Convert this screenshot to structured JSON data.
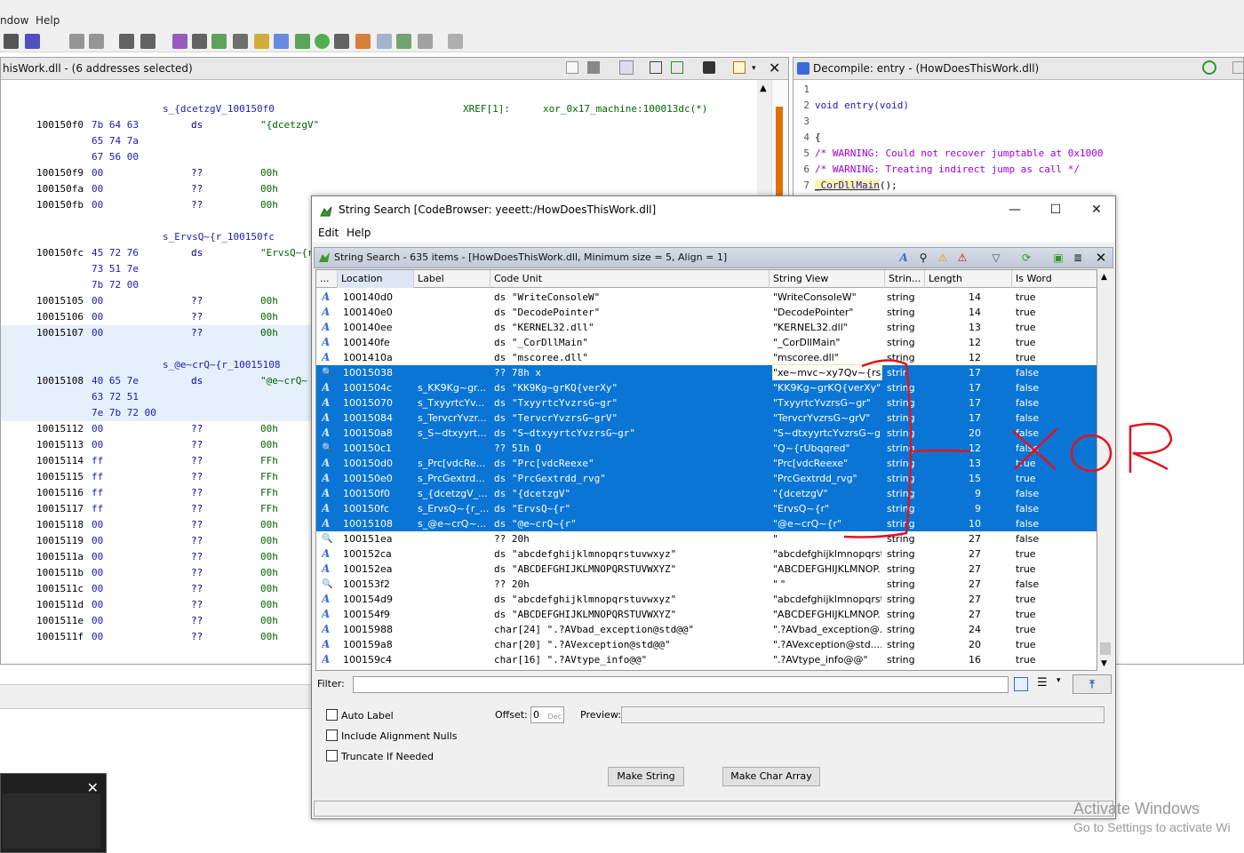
{
  "menubar": {
    "items": [
      "ndow",
      "Help"
    ]
  },
  "toolbar": {
    "icons": [
      "ghidra-logo-icon",
      "bookmark-icon",
      "cut-icon",
      "copy-icon",
      "undo-icon",
      "redo-icon",
      "check-icon",
      "label-icon",
      "export-icon",
      "memory-icon",
      "folder-icon",
      "function-icon",
      "tree-icon",
      "run-icon",
      "terminal-icon",
      "diamond-icon",
      "table-icon",
      "image-icon",
      "person-icon",
      "settings-icon"
    ]
  },
  "listing": {
    "title": "hisWork.dll - (6 addresses selected)",
    "rows": [
      {
        "type": "label",
        "label": "s_{dcetzgV_100150f0",
        "xref": "XREF[1]:",
        "xref_target": "xor_0x17_machine:100013dc(*)"
      },
      {
        "type": "data",
        "addr": "100150f0",
        "bytes": "7b 64 63",
        "mnem": "ds",
        "val": "\"{dcetzgV\""
      },
      {
        "type": "cont",
        "bytes": "65 74 7a"
      },
      {
        "type": "cont",
        "bytes": "67 56 00"
      },
      {
        "type": "data",
        "addr": "100150f9",
        "bytes": "00",
        "mnem": "??",
        "val": "00h"
      },
      {
        "type": "data",
        "addr": "100150fa",
        "bytes": "00",
        "mnem": "??",
        "val": "00h"
      },
      {
        "type": "data",
        "addr": "100150fb",
        "bytes": "00",
        "mnem": "??",
        "val": "00h"
      },
      {
        "type": "blank"
      },
      {
        "type": "label",
        "label": "s_ErvsQ~{r_100150fc"
      },
      {
        "type": "data",
        "addr": "100150fc",
        "bytes": "45 72 76",
        "mnem": "ds",
        "val": "\"ErvsQ~{r"
      },
      {
        "type": "cont",
        "bytes": "73 51 7e"
      },
      {
        "type": "cont",
        "bytes": "7b 72 00"
      },
      {
        "type": "data",
        "addr": "10015105",
        "bytes": "00",
        "mnem": "??",
        "val": "00h"
      },
      {
        "type": "data",
        "addr": "10015106",
        "bytes": "00",
        "mnem": "??",
        "val": "00h"
      },
      {
        "type": "data",
        "addr": "10015107",
        "bytes": "00",
        "mnem": "??",
        "val": "00h"
      },
      {
        "type": "blank"
      },
      {
        "type": "label",
        "label": "s_@e~crQ~{r_10015108"
      },
      {
        "type": "data",
        "addr": "10015108",
        "bytes": "40 65 7e",
        "mnem": "ds",
        "val": "\"@e~crQ~"
      },
      {
        "type": "cont",
        "bytes": "63 72 51"
      },
      {
        "type": "cont",
        "bytes": "7e 7b 72 00"
      },
      {
        "type": "data",
        "addr": "10015112",
        "bytes": "00",
        "mnem": "??",
        "val": "00h"
      },
      {
        "type": "data",
        "addr": "10015113",
        "bytes": "00",
        "mnem": "??",
        "val": "00h"
      },
      {
        "type": "data",
        "addr": "10015114",
        "bytes": "ff",
        "mnem": "??",
        "val": "FFh"
      },
      {
        "type": "data",
        "addr": "10015115",
        "bytes": "ff",
        "mnem": "??",
        "val": "FFh"
      },
      {
        "type": "data",
        "addr": "10015116",
        "bytes": "ff",
        "mnem": "??",
        "val": "FFh"
      },
      {
        "type": "data",
        "addr": "10015117",
        "bytes": "ff",
        "mnem": "??",
        "val": "FFh"
      },
      {
        "type": "data",
        "addr": "10015118",
        "bytes": "00",
        "mnem": "??",
        "val": "00h"
      },
      {
        "type": "data",
        "addr": "10015119",
        "bytes": "00",
        "mnem": "??",
        "val": "00h"
      },
      {
        "type": "data",
        "addr": "1001511a",
        "bytes": "00",
        "mnem": "??",
        "val": "00h"
      },
      {
        "type": "data",
        "addr": "1001511b",
        "bytes": "00",
        "mnem": "??",
        "val": "00h"
      },
      {
        "type": "data",
        "addr": "1001511c",
        "bytes": "00",
        "mnem": "??",
        "val": "00h"
      },
      {
        "type": "data",
        "addr": "1001511d",
        "bytes": "00",
        "mnem": "??",
        "val": "00h"
      },
      {
        "type": "data",
        "addr": "1001511e",
        "bytes": "00",
        "mnem": "??",
        "val": "00h"
      },
      {
        "type": "data",
        "addr": "1001511f",
        "bytes": "00",
        "mnem": "??",
        "val": "00h"
      }
    ]
  },
  "decompile": {
    "title": "Decompile: entry - (HowDoesThisWork.dll)",
    "lines": [
      {
        "n": "1",
        "parts": []
      },
      {
        "n": "2",
        "parts": [
          {
            "c": "kw",
            "t": "void entry(void)"
          }
        ]
      },
      {
        "n": "3",
        "parts": []
      },
      {
        "n": "4",
        "parts": [
          {
            "c": "",
            "t": "{"
          }
        ]
      },
      {
        "n": "5",
        "parts": [
          {
            "c": "cmt",
            "t": "                   /* WARNING: Could not recover jumptable at 0x1000"
          }
        ]
      },
      {
        "n": "6",
        "parts": [
          {
            "c": "cmt",
            "t": "                   /* WARNING: Treating indirect jump as call */"
          }
        ]
      },
      {
        "n": "7",
        "parts": [
          {
            "c": "",
            "t": "  "
          },
          {
            "c": "fn",
            "t": "_CorDllMain"
          },
          {
            "c": "",
            "t": "();"
          }
        ]
      }
    ]
  },
  "dialog": {
    "title": "String Search [CodeBrowser: yeeett:/HowDoesThisWork.dll]",
    "menu": [
      "Edit",
      "Help"
    ],
    "panel_title": "String Search - 635 items - [HowDoesThisWork.dll, Minimum size = 5, Align = 1]",
    "columns": [
      "...",
      "Location",
      "Label",
      "Code Unit",
      "String View",
      "Strin...",
      "Length",
      "Is Word"
    ],
    "rows": [
      {
        "icon": "A",
        "loc": "100140d0",
        "label": "",
        "code": "ds \"WriteConsoleW\"",
        "view": "\"WriteConsoleW\"",
        "type": "string",
        "len": "14",
        "word": "true",
        "sel": false
      },
      {
        "icon": "A",
        "loc": "100140e0",
        "label": "",
        "code": "ds \"DecodePointer\"",
        "view": "\"DecodePointer\"",
        "type": "string",
        "len": "14",
        "word": "true",
        "sel": false
      },
      {
        "icon": "A",
        "loc": "100140ee",
        "label": "",
        "code": "ds \"KERNEL32.dll\"",
        "view": "\"KERNEL32.dll\"",
        "type": "string",
        "len": "13",
        "word": "true",
        "sel": false
      },
      {
        "icon": "A",
        "loc": "100140fe",
        "label": "",
        "code": "ds \"_CorDllMain\"",
        "view": "\"_CorDllMain\"",
        "type": "string",
        "len": "12",
        "word": "true",
        "sel": false
      },
      {
        "icon": "A",
        "loc": "1001410a",
        "label": "",
        "code": "ds \"mscoree.dll\"",
        "view": "\"mscoree.dll\"",
        "type": "string",
        "len": "12",
        "word": "true",
        "sel": false
      },
      {
        "icon": "S",
        "loc": "10015038",
        "label": "",
        "code": "?? 78h    x",
        "view": "\"xe~mvc~xy7Qv~{rs\"",
        "type": "strin",
        "len": "17",
        "word": "false",
        "sel": true
      },
      {
        "icon": "A",
        "loc": "1001504c",
        "label": "s_KK9Kg~gr...",
        "code": "ds \"KK9Kg~grKQ{verXy\"",
        "view": "\"KK9Kg~grKQ{verXy\"",
        "type": "string",
        "len": "17",
        "word": "false",
        "sel": true
      },
      {
        "icon": "A",
        "loc": "10015070",
        "label": "s_TxyyrtcYv...",
        "code": "ds \"TxyyrtcYvzrsG~gr\"",
        "view": "\"TxyyrtcYvzrsG~gr\"",
        "type": "string",
        "len": "17",
        "word": "false",
        "sel": true
      },
      {
        "icon": "A",
        "loc": "10015084",
        "label": "s_TervcrYvzr...",
        "code": "ds \"TervcrYvzrsG~grV\"",
        "view": "\"TervcrYvzrsG~grV\"",
        "type": "string",
        "len": "17",
        "word": "false",
        "sel": true
      },
      {
        "icon": "A",
        "loc": "100150a8",
        "label": "s_S~dtxyyrt...",
        "code": "ds \"S~dtxyyrtcYvzrsG~gr\"",
        "view": "\"S~dtxyyrtcYvzrsG~gr\"",
        "type": "string",
        "len": "20",
        "word": "false",
        "sel": true
      },
      {
        "icon": "S",
        "loc": "100150c1",
        "label": "",
        "code": "?? 51h    Q",
        "view": "\"Q~{rUbqqred\"",
        "type": "string",
        "len": "12",
        "word": "false",
        "sel": true
      },
      {
        "icon": "A",
        "loc": "100150d0",
        "label": "s_Prc[vdcRe...",
        "code": "ds \"Prc[vdcReexe\"",
        "view": "\"Prc[vdcReexe\"",
        "type": "string",
        "len": "13",
        "word": "true",
        "sel": true
      },
      {
        "icon": "A",
        "loc": "100150e0",
        "label": "s_PrcGextrd...",
        "code": "ds \"PrcGextrdd_rvg\"",
        "view": "\"PrcGextrdd_rvg\"",
        "type": "string",
        "len": "15",
        "word": "true",
        "sel": true
      },
      {
        "icon": "A",
        "loc": "100150f0",
        "label": "s_{dcetzgV_...",
        "code": "ds \"{dcetzgV\"",
        "view": "\"{dcetzgV\"",
        "type": "string",
        "len": "9",
        "word": "false",
        "sel": true
      },
      {
        "icon": "A",
        "loc": "100150fc",
        "label": "s_ErvsQ~{r_...",
        "code": "ds \"ErvsQ~{r\"",
        "view": "\"ErvsQ~{r\"",
        "type": "string",
        "len": "9",
        "word": "false",
        "sel": true
      },
      {
        "icon": "A",
        "loc": "10015108",
        "label": "s_@e~crQ~...",
        "code": "ds \"@e~crQ~{r\"",
        "view": "\"@e~crQ~{r\"",
        "type": "string",
        "len": "10",
        "word": "false",
        "sel": true
      },
      {
        "icon": "S",
        "loc": "100151ea",
        "label": "",
        "code": "?? 20h",
        "view": "\"",
        "type": "string",
        "len": "27",
        "word": "false",
        "sel": false
      },
      {
        "icon": "A",
        "loc": "100152ca",
        "label": "",
        "code": "ds \"abcdefghijklmnopqrstuvwxyz\"",
        "view": "\"abcdefghijklmnopqrst...",
        "type": "string",
        "len": "27",
        "word": "true",
        "sel": false
      },
      {
        "icon": "A",
        "loc": "100152ea",
        "label": "",
        "code": "ds \"ABCDEFGHIJKLMNOPQRSTUVWXYZ\"",
        "view": "\"ABCDEFGHIJKLMNOP...",
        "type": "string",
        "len": "27",
        "word": "true",
        "sel": false
      },
      {
        "icon": "S",
        "loc": "100153f2",
        "label": "",
        "code": "?? 20h",
        "view": "\"                \"",
        "type": "string",
        "len": "27",
        "word": "false",
        "sel": false
      },
      {
        "icon": "A",
        "loc": "100154d9",
        "label": "",
        "code": "ds \"abcdefghijklmnopqrstuvwxyz\"",
        "view": "\"abcdefghijklmnopqrst...",
        "type": "string",
        "len": "27",
        "word": "true",
        "sel": false
      },
      {
        "icon": "A",
        "loc": "100154f9",
        "label": "",
        "code": "ds \"ABCDEFGHIJKLMNOPQRSTUVWXYZ\"",
        "view": "\"ABCDEFGHIJKLMNOP...",
        "type": "string",
        "len": "27",
        "word": "true",
        "sel": false
      },
      {
        "icon": "A",
        "loc": "10015988",
        "label": "",
        "code": "char[24] \".?AVbad_exception@std@@\"",
        "view": "\".?AVbad_exception@...",
        "type": "string",
        "len": "24",
        "word": "true",
        "sel": false
      },
      {
        "icon": "A",
        "loc": "100159a8",
        "label": "",
        "code": "char[20] \".?AVexception@std@@\"",
        "view": "\".?AVexception@std....",
        "type": "string",
        "len": "20",
        "word": "true",
        "sel": false
      },
      {
        "icon": "A",
        "loc": "100159c4",
        "label": "",
        "code": "char[16] \".?AVtype_info@@\"",
        "view": "\".?AVtype_info@@\"",
        "type": "string",
        "len": "16",
        "word": "true",
        "sel": false
      }
    ],
    "filter_label": "Filter:",
    "filter_value": "",
    "auto_label": "Auto Label",
    "include_nulls": "Include Alignment Nulls",
    "truncate": "Truncate If Needed",
    "offset_label": "Offset:",
    "offset_value": "0",
    "offset_unit": "Dec",
    "preview_label": "Preview:",
    "make_string": "Make String",
    "make_char_array": "Make Char Array"
  },
  "annotation": {
    "text": "XOR",
    "color": "#e0141e"
  },
  "watermark": {
    "line1": "Activate Windows",
    "line2": "Go to Settings to activate Wi"
  },
  "colors": {
    "selection": "#0a75d4",
    "header": "#c2cad8"
  }
}
